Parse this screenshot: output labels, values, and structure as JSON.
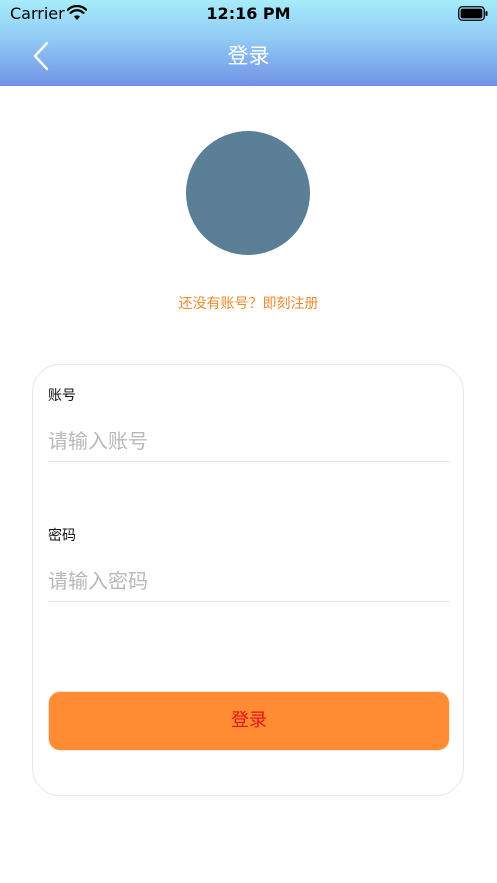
{
  "status_bar": {
    "carrier": "Carrier",
    "time": "12:16 PM"
  },
  "nav": {
    "title": "登录",
    "back_icon": "chevron-left-icon"
  },
  "avatar": {
    "color": "#5a7f96"
  },
  "register_link": "还没有账号？即刻注册",
  "form": {
    "account": {
      "label": "账号",
      "placeholder": "请输入账号",
      "value": ""
    },
    "password": {
      "label": "密码",
      "placeholder": "请输入密码",
      "value": ""
    },
    "login_button": "登录"
  },
  "colors": {
    "accent": "#ff8c32",
    "link": "#f08a2c",
    "button_text": "#e8141a",
    "header_top": "#a6ecfa",
    "header_bottom": "#6f92e6"
  }
}
